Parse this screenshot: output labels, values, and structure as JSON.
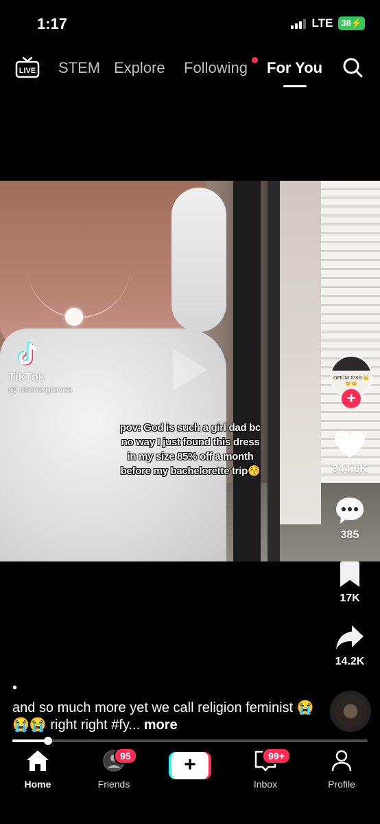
{
  "status_bar": {
    "time": "1:17",
    "network": "LTE",
    "battery": "38"
  },
  "top_nav": {
    "live_label": "LIVE",
    "tabs": [
      {
        "label": "STEM"
      },
      {
        "label": "Explore"
      },
      {
        "label": "Following"
      },
      {
        "label": "For You"
      }
    ],
    "active_tab": "For You"
  },
  "video": {
    "watermark_brand": "TikTok",
    "watermark_handle": "@ clairekgroves",
    "caption_overlay": "pov: God is such a girl dad bc no way I just found this dress in my size 85% off a month before my bachelorette trip😚",
    "creator_avatar_text": "OPIUM JOSH 👑👑👑"
  },
  "actions": {
    "likes": "344.6K",
    "comments": "385",
    "saves": "17K",
    "shares": "14.2K"
  },
  "description": {
    "dot": "•",
    "text": "and so much more yet we call religion feminist 😭😭😭 right right #fy...",
    "more_label": "more"
  },
  "playback_progress": 0.1,
  "tab_bar": {
    "home": "Home",
    "friends": "Friends",
    "friends_badge": "95",
    "inbox": "Inbox",
    "inbox_badge": "99+",
    "profile": "Profile",
    "create_symbol": "+"
  },
  "colors": {
    "accent": "#fe2c55",
    "cyan": "#25f4ee",
    "battery": "#34c759"
  }
}
